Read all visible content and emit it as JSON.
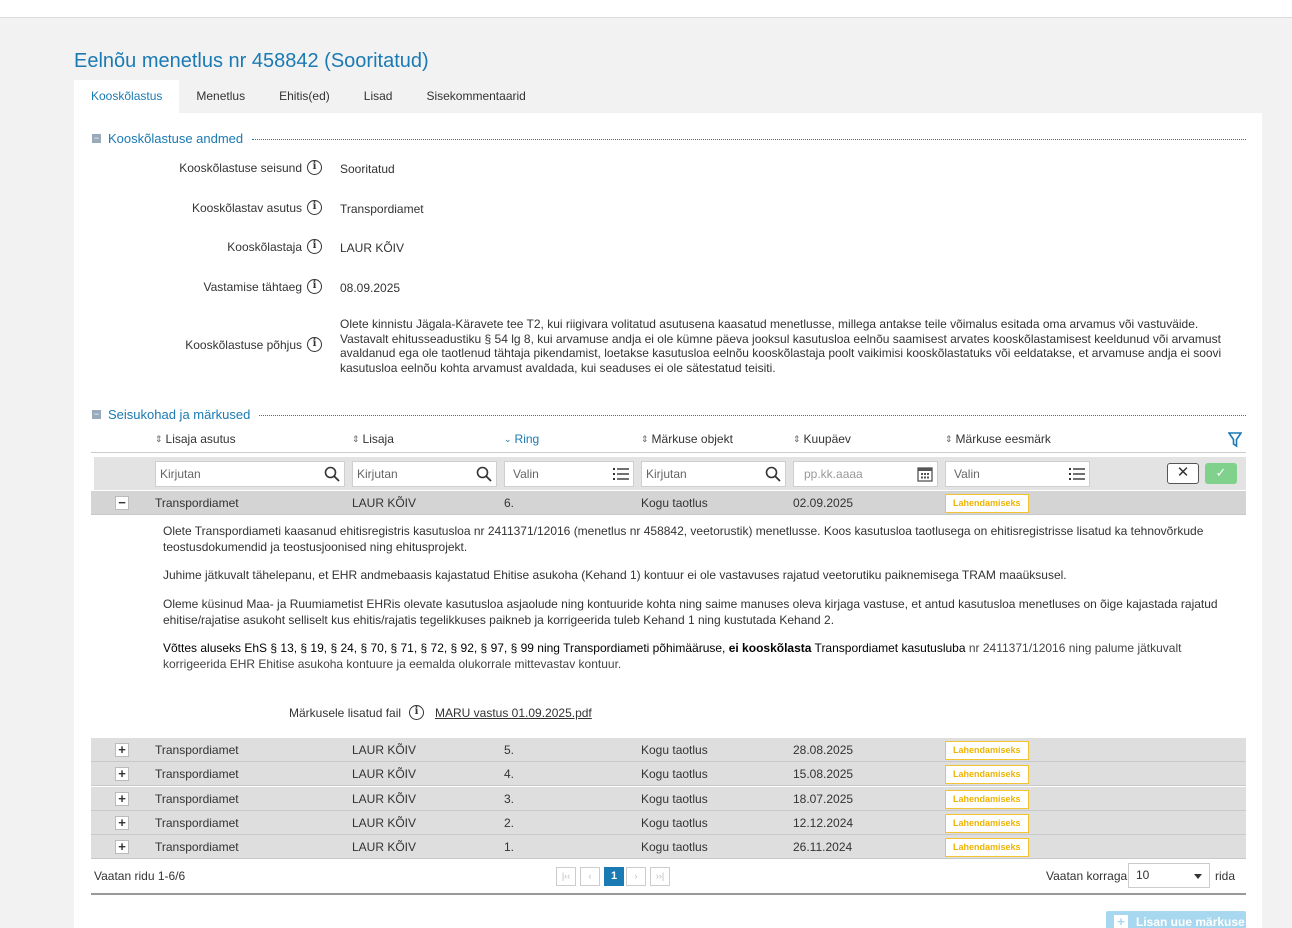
{
  "page": {
    "title": "Eelnõu menetlus nr 458842 (Sooritatud)",
    "tabs": [
      "Kooskõlastus",
      "Menetlus",
      "Ehitis(ed)",
      "Lisad",
      "Sisekommentaarid"
    ],
    "active_tab": "Kooskõlastus"
  },
  "section1": {
    "title": "Kooskõlastuse andmed",
    "fields": [
      {
        "label": "Kooskõlastuse seisund",
        "value": "Sooritatud"
      },
      {
        "label": "Kooskõlastav asutus",
        "value": "Transpordiamet"
      },
      {
        "label": "Kooskõlastaja",
        "value": "LAUR KÕIV"
      },
      {
        "label": "Vastamise tähtaeg",
        "value": "08.09.2025"
      },
      {
        "label": "Kooskõlastuse põhjus",
        "value": "Olete kinnistu Jägala-Käravete tee T2, kui riigivara volitatud asutusena kaasatud menetlusse, millega antakse teile võimalus esitada oma arvamus või vastuväide. Vastavalt ehitusseadustiku § 54 lg 8, kui arvamuse andja ei ole kümne päeva jooksul kasutusloa eelnõu saamisest arvates kooskõlastamisest keeldunud või arvamust avaldanud ega ole taotlenud tähtaja pikendamist, loetakse kasutusloa eelnõu kooskõlastaja poolt vaikimisi kooskõlastatuks või eeldatakse, et arvamuse andja ei soovi kasutusloa eelnõu kohta arvamust avaldada, kui seaduses ei ole sätestatud teisiti."
      }
    ]
  },
  "section2": {
    "title": "Seisukohad ja märkused",
    "columns": [
      "Lisaja asutus",
      "Lisaja",
      "Ring",
      "Märkuse objekt",
      "Kuupäev",
      "Märkuse eesmärk"
    ],
    "filters": {
      "asutus": "Kirjutan",
      "lisaja": "Kirjutan",
      "ring": "Valin",
      "objekt": "Kirjutan",
      "kuupaev": "pp.kk.aaaa",
      "eesmark": "Valin"
    },
    "rows": [
      {
        "asutus": "Transpordiamet",
        "lisaja": "LAUR KÕIV",
        "ring": "6.",
        "objekt": "Kogu taotlus",
        "kuupaev": "02.09.2025",
        "eesmark": "Lahendamiseks"
      },
      {
        "asutus": "Transpordiamet",
        "lisaja": "LAUR KÕIV",
        "ring": "5.",
        "objekt": "Kogu taotlus",
        "kuupaev": "28.08.2025",
        "eesmark": "Lahendamiseks"
      },
      {
        "asutus": "Transpordiamet",
        "lisaja": "LAUR KÕIV",
        "ring": "4.",
        "objekt": "Kogu taotlus",
        "kuupaev": "15.08.2025",
        "eesmark": "Lahendamiseks"
      },
      {
        "asutus": "Transpordiamet",
        "lisaja": "LAUR KÕIV",
        "ring": "3.",
        "objekt": "Kogu taotlus",
        "kuupaev": "18.07.2025",
        "eesmark": "Lahendamiseks"
      },
      {
        "asutus": "Transpordiamet",
        "lisaja": "LAUR KÕIV",
        "ring": "2.",
        "objekt": "Kogu taotlus",
        "kuupaev": "12.12.2024",
        "eesmark": "Lahendamiseks"
      },
      {
        "asutus": "Transpordiamet",
        "lisaja": "LAUR KÕIV",
        "ring": "1.",
        "objekt": "Kogu taotlus",
        "kuupaev": "26.11.2024",
        "eesmark": "Lahendamiseks"
      }
    ],
    "detail": {
      "p1": "Olete Transpordiameti kaasanud ehitisregistris kasutusloa nr 2411371/12016 (menetlus nr 458842, veetorustik) menetlusse. Koos kasutusloa taotlusega on ehitisregistrisse lisatud ka tehnovõrkude teostusdokumendid ja teostusjoonised ning ehitusprojekt.",
      "p2": "Juhime jätkuvalt tähelepanu, et EHR andmebaasis kajastatud Ehitise asukoha (Kehand 1) kontuur ei ole vastavuses rajatud veetorutiku paiknemisega TRAM maaüksusel.",
      "p3": "Oleme küsinud Maa- ja Ruumiametist EHRis olevate kasutusloa asjaolude ning kontuuride kohta ning saime manuses oleva kirjaga vastuse, et antud kasutusloa menetluses on õige kajastada rajatud ehitise/rajatise asukoht selliselt kus ehitis/rajatis tegelikkuses paikneb ja korrigeerida tuleb Kehand 1 ning kustutada Kehand 2.",
      "p4_a": "Võttes aluseks EhS § 13, § 19, § 24, § 70, § 71, § 72, § 92, § 97, § 99 ning Transpordiameti põhimääruse, ",
      "p4_b": "ei kooskõlasta",
      "p4_c": " Transpordiamet kasutusluba ",
      "p4_d": "nr 2411371/12016 ning palume jätkuvalt korrigeerida EHR Ehitise asukoha kontuure ja eemalda olukorrale mittevastav kontuur.",
      "attachment_label": "Märkusele lisatud fail",
      "attachment_file": "MARU vastus 01.09.2025.pdf"
    },
    "footer": {
      "rows_info": "Vaatan ridu 1-6/6",
      "current_page": "1",
      "per_page_label": "Vaatan korraga",
      "per_page_value": "10",
      "rows_suffix": "rida",
      "add_button": "Lisan uue märkuse"
    }
  },
  "colors": {
    "accent": "#1a7ab3",
    "badge": "#f0b400",
    "ok_button": "#7fd18b"
  }
}
